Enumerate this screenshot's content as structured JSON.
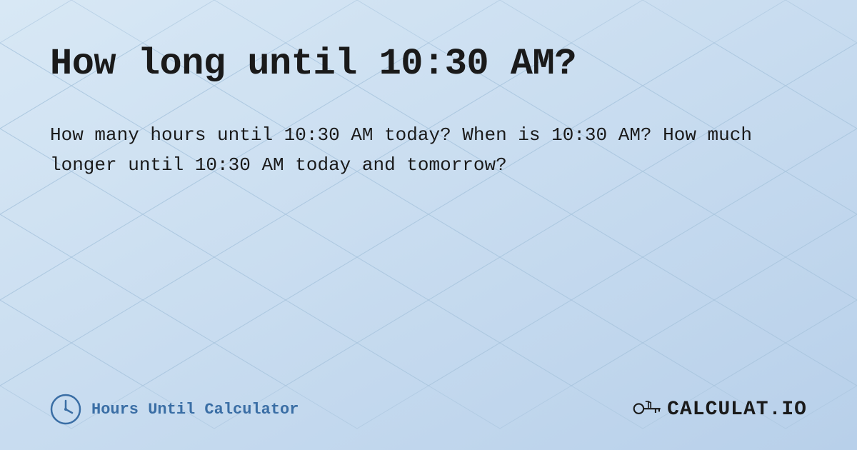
{
  "page": {
    "title": "How long until 10:30 AM?",
    "description": "How many hours until 10:30 AM today? When is 10:30 AM? How much longer until 10:30 AM today and tomorrow?",
    "background_color": "#c8ddf0"
  },
  "footer": {
    "left_label": "Hours Until Calculator",
    "logo_text": "CALCULAT.IO"
  },
  "icons": {
    "clock": "clock-icon",
    "logo": "logo-icon"
  }
}
